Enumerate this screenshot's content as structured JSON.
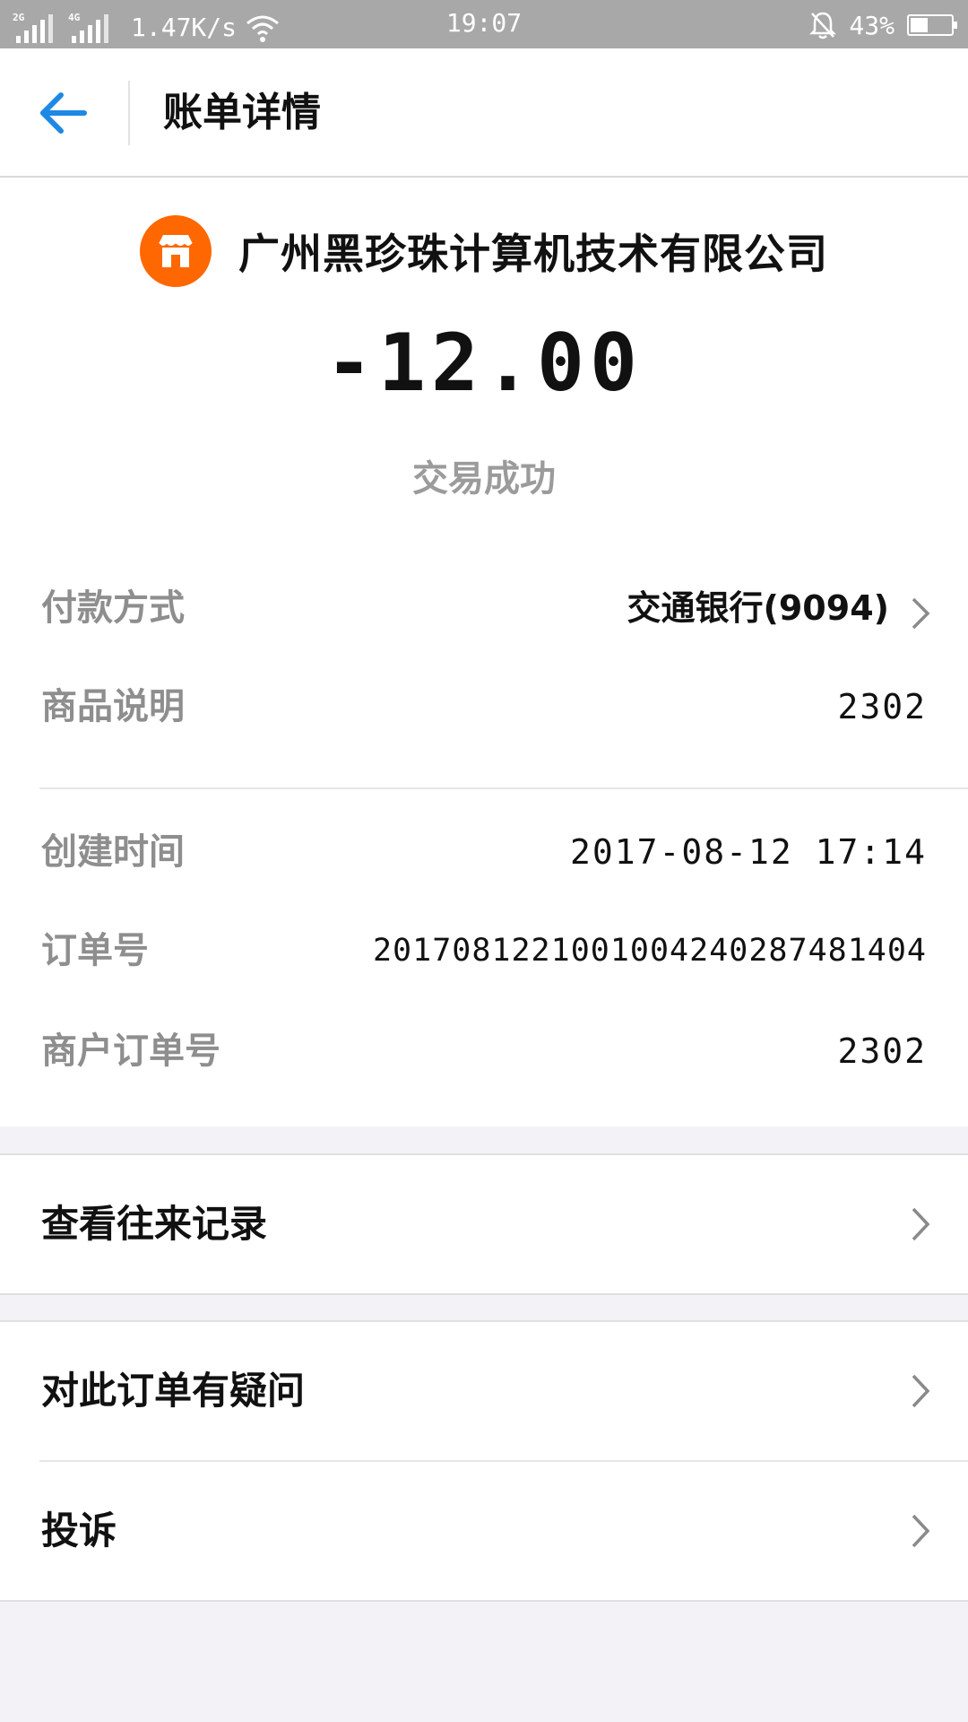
{
  "status_bar": {
    "net1": "2G",
    "net2": "4G",
    "speed": "1.47K/s",
    "time": "19:07",
    "battery": "43%",
    "battery_level": 0.43
  },
  "header": {
    "title": "账单详情"
  },
  "summary": {
    "merchant": "广州黑珍珠计算机技术有限公司",
    "amount": "-12.00",
    "status": "交易成功"
  },
  "details": {
    "payment_label": "付款方式",
    "payment_value": "交通银行(9094)",
    "goods_label": "商品说明",
    "goods_value": "2302",
    "created_label": "创建时间",
    "created_value": "2017-08-12 17:14",
    "order_label": "订单号",
    "order_value": "2017081221001004240287481404",
    "merchant_order_label": "商户订单号",
    "merchant_order_value": "2302"
  },
  "links": {
    "history": "查看往来记录",
    "question": "对此订单有疑问",
    "complaint": "投诉"
  },
  "colors": {
    "accent": "#1e88e5",
    "merchant_logo": "#ff6700",
    "label_gray": "#8e8e8e"
  }
}
